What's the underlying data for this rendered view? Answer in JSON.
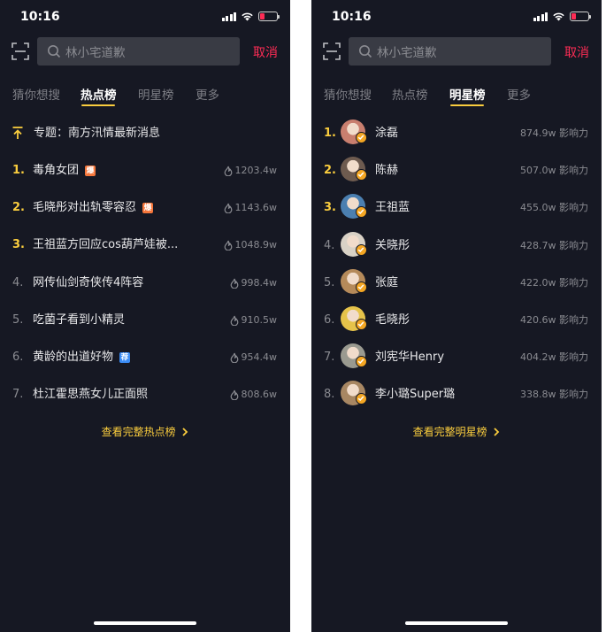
{
  "left": {
    "status_time": "10:16",
    "search_placeholder": "林小宅道歉",
    "cancel": "取消",
    "tabs": [
      "猜你想搜",
      "热点榜",
      "明星榜",
      "更多"
    ],
    "topic": "专题：南方汛情最新消息",
    "items": [
      {
        "rank": "1.",
        "title": "毒角女团",
        "tag": "爆",
        "tag_color": "#f5763b",
        "heat": "1203.4w"
      },
      {
        "rank": "2.",
        "title": "毛晓彤对出轨零容忍",
        "tag": "爆",
        "tag_color": "#f5763b",
        "heat": "1143.6w"
      },
      {
        "rank": "3.",
        "title": "王祖蓝方回应cos葫芦娃被...",
        "heat": "1048.9w"
      },
      {
        "rank": "4.",
        "title": "网传仙剑奇侠传4阵容",
        "heat": "998.4w"
      },
      {
        "rank": "5.",
        "title": "吃菌子看到小精灵",
        "heat": "910.5w"
      },
      {
        "rank": "6.",
        "title": "黄龄的出道好物",
        "tag": "荐",
        "tag_color": "#3b8cf5",
        "heat": "954.4w"
      },
      {
        "rank": "7.",
        "title": "杜江霍思燕女儿正面照",
        "heat": "808.6w"
      }
    ],
    "more_link": "查看完整热点榜"
  },
  "right": {
    "status_time": "10:16",
    "search_placeholder": "林小宅道歉",
    "cancel": "取消",
    "tabs": [
      "猜你想搜",
      "热点榜",
      "明星榜",
      "更多"
    ],
    "stars": [
      {
        "rank": "1.",
        "name": "涂磊",
        "score": "874.9w 影响力",
        "avatar_color": "#c97f6f"
      },
      {
        "rank": "2.",
        "name": "陈赫",
        "score": "507.0w 影响力",
        "avatar_color": "#6e5b4f"
      },
      {
        "rank": "3.",
        "name": "王祖蓝",
        "score": "455.0w 影响力",
        "avatar_color": "#4b7fb0"
      },
      {
        "rank": "4.",
        "name": "关晓彤",
        "score": "428.7w 影响力",
        "avatar_color": "#d9d2c6"
      },
      {
        "rank": "5.",
        "name": "张庭",
        "score": "422.0w 影响力",
        "avatar_color": "#b58a5a"
      },
      {
        "rank": "6.",
        "name": "毛晓彤",
        "score": "420.6w 影响力",
        "avatar_color": "#e6c34a"
      },
      {
        "rank": "7.",
        "name": "刘宪华Henry",
        "score": "404.2w 影响力",
        "avatar_color": "#9a9a90"
      },
      {
        "rank": "8.",
        "name": "李小璐Super璐",
        "score": "338.8w 影响力",
        "avatar_color": "#a88763"
      }
    ],
    "more_link": "查看完整明星榜"
  },
  "colors": {
    "accent": "#facd3e",
    "cancel": "#fe2c55",
    "background": "#161823"
  },
  "icons": [
    "scan-icon",
    "search-icon",
    "flame-icon",
    "topic-arrow-icon",
    "verified-badge-icon",
    "chevron-right-icon"
  ]
}
